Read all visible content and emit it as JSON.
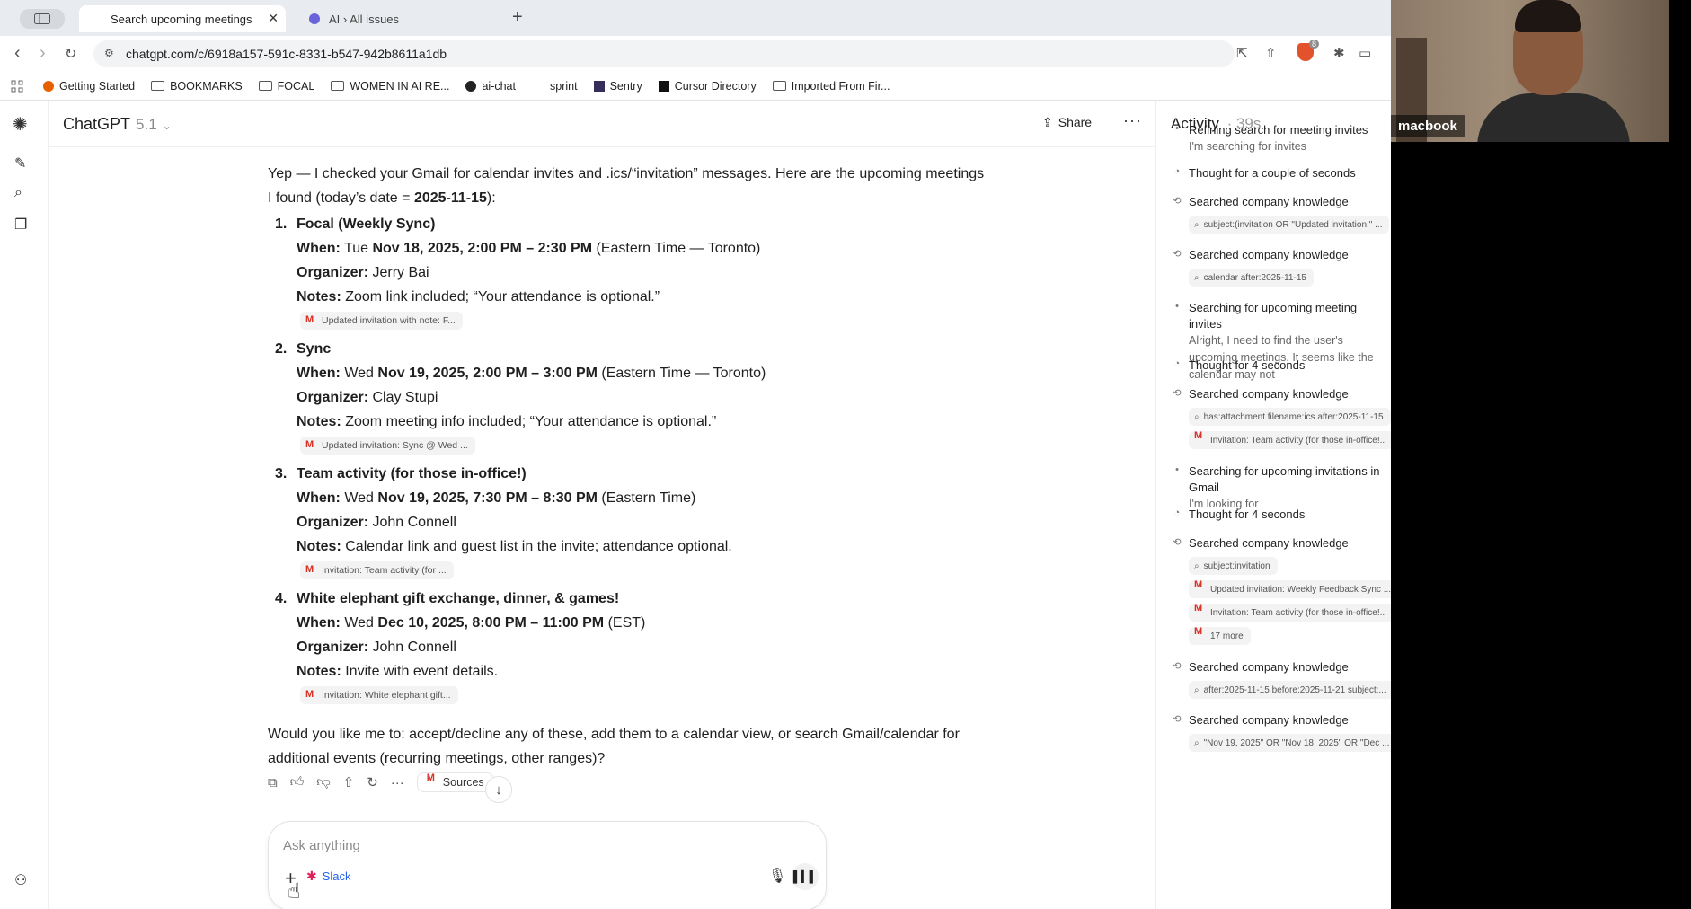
{
  "browser": {
    "tabs": [
      {
        "label": "Search upcoming meetings",
        "active": true
      },
      {
        "label": "AI › All issues",
        "active": false
      }
    ],
    "url": "chatgpt.com/c/6918a157-591c-8331-b547-942b8611a1db",
    "shield_badge": "8",
    "bookmarks": [
      {
        "label": "Getting Started",
        "icon": "firefox-icon"
      },
      {
        "label": "BOOKMARKS",
        "icon": "folder-icon"
      },
      {
        "label": "FOCAL",
        "icon": "folder-icon"
      },
      {
        "label": "WOMEN IN AI RE...",
        "icon": "folder-icon"
      },
      {
        "label": "ai-chat",
        "icon": "github-icon"
      },
      {
        "label": "sprint",
        "icon": "none"
      },
      {
        "label": "Sentry",
        "icon": "sentry-icon"
      },
      {
        "label": "Cursor Directory",
        "icon": "cursor-icon"
      },
      {
        "label": "Imported From Fir...",
        "icon": "folder-icon"
      }
    ]
  },
  "app": {
    "model_name": "ChatGPT",
    "model_version": "5.1",
    "share_label": "Share"
  },
  "message": {
    "intro_a": "Yep — I checked your Gmail for calendar invites and .ics/“invitation” messages. Here are the upcoming meetings I found (today’s date = ",
    "intro_date": "2025-11-15",
    "intro_b": "):",
    "when_label": "When:",
    "organizer_label": "Organizer:",
    "notes_label": "Notes:",
    "meetings": [
      {
        "num": "1.",
        "title": "Focal (Weekly Sync)",
        "day": "Tue",
        "when_bold": "Nov 18, 2025, 2:00 PM – 2:30 PM",
        "tz": "(Eastern Time — Toronto)",
        "organizer": "Jerry Bai",
        "notes": "Zoom link included; “Your attendance is optional.”",
        "source": "Updated invitation with note: F..."
      },
      {
        "num": "2.",
        "title": "Sync",
        "day": "Wed",
        "when_bold": "Nov 19, 2025, 2:00 PM – 3:00 PM",
        "tz": "(Eastern Time — Toronto)",
        "organizer": "Clay Stupi",
        "notes": "Zoom meeting info included; “Your attendance is optional.”",
        "source": "Updated invitation: Sync @ Wed ..."
      },
      {
        "num": "3.",
        "title": "Team activity (for those in-office!)",
        "day": "Wed",
        "when_bold": "Nov 19, 2025, 7:30 PM – 8:30 PM",
        "tz": "(Eastern Time)",
        "organizer": "John Connell",
        "notes": "Calendar link and guest list in the invite; attendance optional.",
        "source": "Invitation: Team activity (for ..."
      },
      {
        "num": "4.",
        "title": "White elephant gift exchange, dinner, & games!",
        "day": "Wed",
        "when_bold": "Dec 10, 2025, 8:00 PM – 11:00 PM",
        "tz": "(EST)",
        "organizer": "John Connell",
        "notes": "Invite with event details.",
        "source": "Invitation: White elephant gift..."
      }
    ],
    "closing": "Would you like me to: accept/decline any of these, add them to a calendar view, or search Gmail/calendar for additional events (recurring meetings, other ranges)?"
  },
  "actions": {
    "sources_label": "Sources"
  },
  "composer": {
    "placeholder": "Ask anything",
    "connector": "Slack"
  },
  "activity": {
    "title": "Activity",
    "elapsed": "· 39s",
    "items": [
      {
        "type": "dot",
        "title": "Refining search for meeting invites",
        "sub": "I'm searching for invites",
        "chips": []
      },
      {
        "type": "thought",
        "title": "Thought for a couple of seconds",
        "sub": "",
        "chips": []
      },
      {
        "type": "search",
        "title": "Searched company knowledge",
        "sub": "",
        "chips": [
          {
            "icon": "search",
            "text": "subject:(invitation OR \"Updated invitation:\" ..."
          }
        ]
      },
      {
        "type": "search",
        "title": "Searched company knowledge",
        "sub": "",
        "chips": [
          {
            "icon": "search",
            "text": "calendar after:2025-11-15"
          }
        ]
      },
      {
        "type": "dot",
        "title": "Searching for upcoming meeting invites",
        "sub": "Alright, I need to find the user's upcoming meetings. It seems like the calendar may not",
        "chips": []
      },
      {
        "type": "thought",
        "title": "Thought for 4 seconds",
        "sub": "",
        "chips": []
      },
      {
        "type": "search",
        "title": "Searched company knowledge",
        "sub": "",
        "chips": [
          {
            "icon": "search",
            "text": "has:attachment filename:ics after:2025-11-15"
          },
          {
            "icon": "gmail",
            "text": "Invitation: Team activity (for those in-office!..."
          }
        ]
      },
      {
        "type": "dot",
        "title": "Searching for upcoming invitations in Gmail",
        "sub": "I'm looking for",
        "chips": []
      },
      {
        "type": "thought",
        "title": "Thought for 4 seconds",
        "sub": "",
        "chips": []
      },
      {
        "type": "search",
        "title": "Searched company knowledge",
        "sub": "",
        "chips": [
          {
            "icon": "search",
            "text": "subject:invitation"
          },
          {
            "icon": "gmail",
            "text": "Updated invitation: Weekly Feedback Sync ..."
          },
          {
            "icon": "gmail",
            "text": "Invitation: Team activity (for those in-office!..."
          },
          {
            "icon": "gmail",
            "text": "17 more"
          }
        ]
      },
      {
        "type": "search",
        "title": "Searched company knowledge",
        "sub": "",
        "chips": [
          {
            "icon": "search",
            "text": "after:2025-11-15 before:2025-11-21 subject:..."
          }
        ]
      },
      {
        "type": "search",
        "title": "Searched company knowledge",
        "sub": "",
        "chips": [
          {
            "icon": "search",
            "text": "\"Nov 19, 2025\" OR \"Nov 18, 2025\" OR \"Dec ..."
          }
        ]
      }
    ]
  },
  "webcam": {
    "name": "macbook"
  },
  "colors": {
    "accent_blue": "#2563eb",
    "gmail_red": "#d93025",
    "brave_orange": "#e2532d"
  }
}
